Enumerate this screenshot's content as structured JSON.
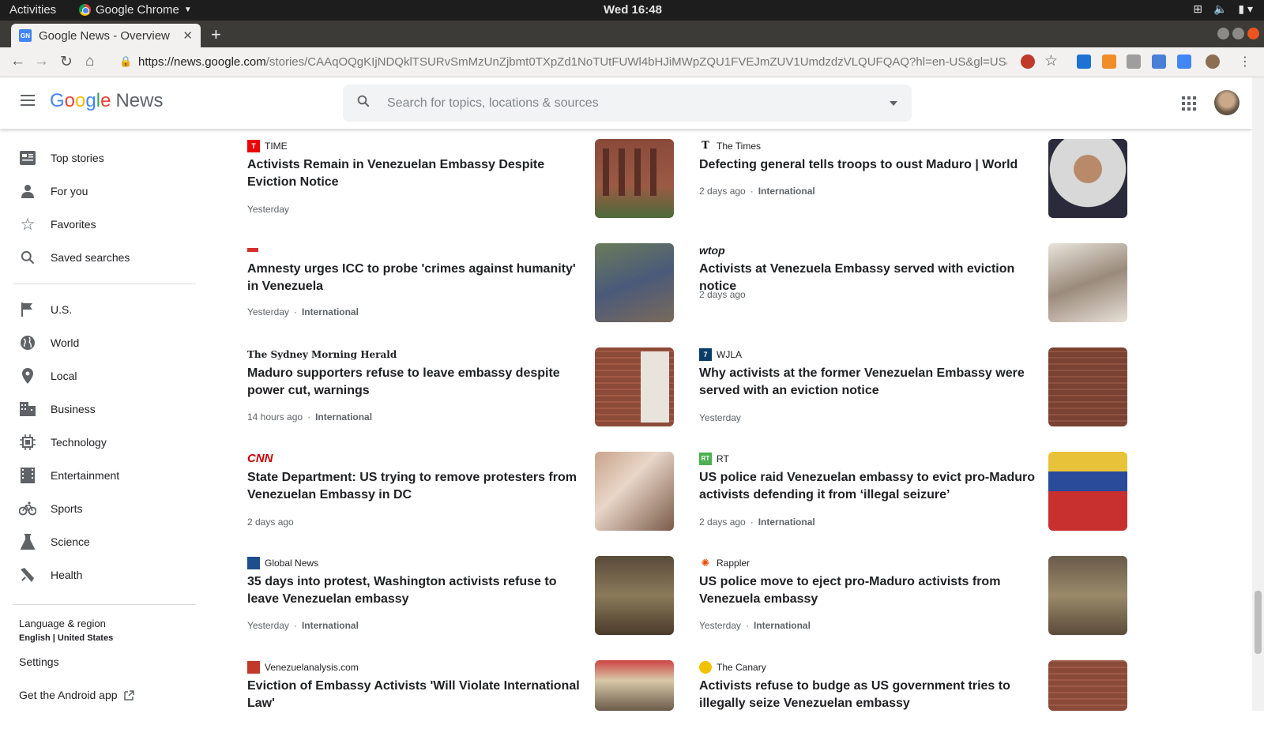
{
  "os": {
    "activities": "Activities",
    "app_name": "Google Chrome",
    "clock": "Wed 16:48"
  },
  "browser": {
    "tab_title": "Google News - Overview",
    "url_domain": "https://news.google.com",
    "url_path": "/stories/CAAqOQgKIjNDQklTSURvSmMzUnZjbmt0TXpZd1NoTUtFUWl4bHJiMWpZQU1FVEJmZUV1UmdzdzVLQUFQAQ?hl=en-US&gl=US&ceid=US..."
  },
  "header": {
    "logo_google": "Google",
    "logo_news": "News",
    "search_placeholder": "Search for topics, locations & sources"
  },
  "sidebar": {
    "items": [
      {
        "label": "Top stories",
        "icon": "top-stories-icon"
      },
      {
        "label": "For you",
        "icon": "person-icon"
      },
      {
        "label": "Favorites",
        "icon": "star-icon"
      },
      {
        "label": "Saved searches",
        "icon": "search-icon"
      },
      {
        "label": "U.S.",
        "icon": "flag-icon"
      },
      {
        "label": "World",
        "icon": "globe-icon"
      },
      {
        "label": "Local",
        "icon": "location-pin-icon"
      },
      {
        "label": "Business",
        "icon": "building-icon"
      },
      {
        "label": "Technology",
        "icon": "chip-icon"
      },
      {
        "label": "Entertainment",
        "icon": "film-icon"
      },
      {
        "label": "Sports",
        "icon": "bike-icon"
      },
      {
        "label": "Science",
        "icon": "flask-icon"
      },
      {
        "label": "Health",
        "icon": "health-icon"
      }
    ],
    "language_title": "Language & region",
    "language_value": "English | United States",
    "settings": "Settings",
    "android": "Get the Android app"
  },
  "articles": [
    {
      "source": "TIME",
      "headline": "Activists Remain in Venezuelan Embassy Despite Eviction Notice",
      "time": "Yesterday",
      "section": ""
    },
    {
      "source": "The Times",
      "headline": "Defecting general tells troops to oust Maduro | World",
      "time": "2 days ago",
      "section": "International"
    },
    {
      "source": "",
      "headline": "Amnesty urges ICC to probe 'crimes against humanity' in Venezuela",
      "time": "Yesterday",
      "section": "International"
    },
    {
      "source": "wtop",
      "headline": "Activists at Venezuela Embassy served with eviction notice",
      "time": "2 days ago",
      "section": ""
    },
    {
      "source": "The Sydney Morning Herald",
      "headline": "Maduro supporters refuse to leave embassy despite power cut, warnings",
      "time": "14 hours ago",
      "section": "International"
    },
    {
      "source": "WJLA",
      "headline": "Why activists at the former Venezuelan Embassy were served with an eviction notice",
      "time": "Yesterday",
      "section": ""
    },
    {
      "source": "CNN",
      "headline": "State Department: US trying to remove protesters from Venezuelan Embassy in DC",
      "time": "2 days ago",
      "section": ""
    },
    {
      "source": "RT",
      "headline": "US police raid Venezuelan embassy to evict pro-Maduro activists defending it from ‘illegal seizure’",
      "time": "2 days ago",
      "section": "International"
    },
    {
      "source": "Global News",
      "headline": "35 days into protest, Washington activists refuse to leave Venezuelan embassy",
      "time": "Yesterday",
      "section": "International"
    },
    {
      "source": "Rappler",
      "headline": "US police move to eject pro-Maduro activists from Venezuela embassy",
      "time": "Yesterday",
      "section": "International"
    },
    {
      "source": "Venezuelanalysis.com",
      "headline": "Eviction of Embassy Activists 'Will Violate International Law'",
      "time": "",
      "section": ""
    },
    {
      "source": "The Canary",
      "headline": "Activists refuse to budge as US government tries to illegally seize Venezuelan embassy",
      "time": "",
      "section": ""
    }
  ],
  "colors": {
    "google_blue": "#4285f4",
    "text": "#202124",
    "muted": "#5f6368"
  }
}
